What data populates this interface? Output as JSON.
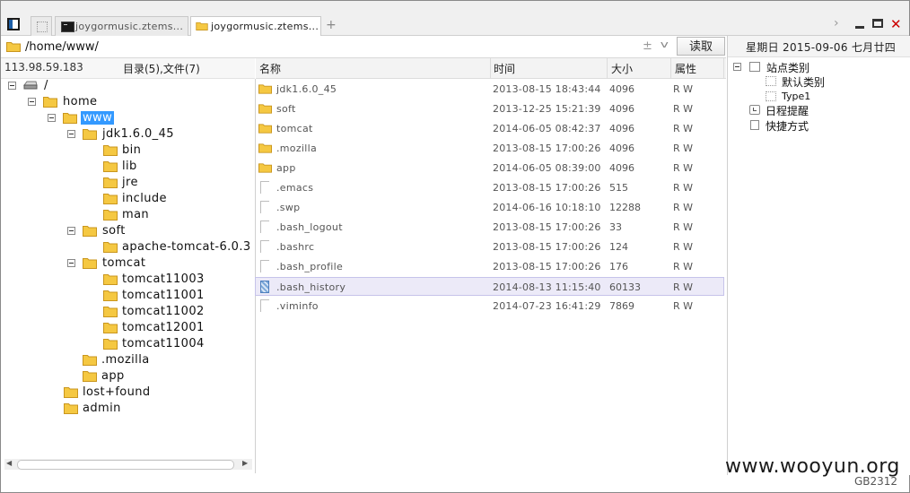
{
  "tabs": [
    {
      "label": "joygormusic.ztems..."
    },
    {
      "label": "joygormusic.ztems..."
    }
  ],
  "path": {
    "value": "/home/www/",
    "plus_minus": "±",
    "read_button": "读取"
  },
  "left_header": {
    "ip": "113.98.59.183",
    "counts": "目录(5),文件(7)"
  },
  "columns": {
    "name": "名称",
    "time": "时间",
    "size": "大小",
    "attr": "属性"
  },
  "tree": {
    "root": "/",
    "home": "home",
    "www": "www",
    "jdk": "jdk1.6.0_45",
    "bin": "bin",
    "lib": "lib",
    "jre": "jre",
    "include": "include",
    "man": "man",
    "soft": "soft",
    "apache": "apache-tomcat-6.0.3",
    "tomcat": "tomcat",
    "t11003": "tomcat11003",
    "t11001": "tomcat11001",
    "t11002": "tomcat11002",
    "t12001": "tomcat12001",
    "t11004": "tomcat11004",
    "mozilla": ".mozilla",
    "app": "app",
    "lostfound": "lost+found",
    "admin": "admin"
  },
  "files": [
    {
      "name": "jdk1.6.0_45",
      "time": "2013-08-15 18:43:44",
      "size": "4096",
      "attr": "R W",
      "type": "folder"
    },
    {
      "name": "soft",
      "time": "2013-12-25 15:21:39",
      "size": "4096",
      "attr": "R W",
      "type": "folder"
    },
    {
      "name": "tomcat",
      "time": "2014-06-05 08:42:37",
      "size": "4096",
      "attr": "R W",
      "type": "folder"
    },
    {
      "name": ".mozilla",
      "time": "2013-08-15 17:00:26",
      "size": "4096",
      "attr": "R W",
      "type": "folder"
    },
    {
      "name": "app",
      "time": "2014-06-05 08:39:00",
      "size": "4096",
      "attr": "R W",
      "type": "folder"
    },
    {
      "name": ".emacs",
      "time": "2013-08-15 17:00:26",
      "size": "515",
      "attr": "R W",
      "type": "file"
    },
    {
      "name": ".swp",
      "time": "2014-06-16 10:18:10",
      "size": "12288",
      "attr": "R W",
      "type": "file"
    },
    {
      "name": ".bash_logout",
      "time": "2013-08-15 17:00:26",
      "size": "33",
      "attr": "R W",
      "type": "file"
    },
    {
      "name": ".bashrc",
      "time": "2013-08-15 17:00:26",
      "size": "124",
      "attr": "R W",
      "type": "file"
    },
    {
      "name": ".bash_profile",
      "time": "2013-08-15 17:00:26",
      "size": "176",
      "attr": "R W",
      "type": "file"
    },
    {
      "name": ".bash_history",
      "time": "2014-08-13 11:15:40",
      "size": "60133",
      "attr": "R W",
      "type": "file",
      "selected": true
    },
    {
      "name": ".viminfo",
      "time": "2014-07-23 16:41:29",
      "size": "7869",
      "attr": "R W",
      "type": "file"
    }
  ],
  "side": {
    "date": "星期日 2015-09-06 七月廿四",
    "site_category": "站点类别",
    "default_category": "默认类别",
    "type1": "Type1",
    "schedule": "日程提醒",
    "shortcuts": "快捷方式"
  },
  "watermark": "www.wooyun.org",
  "encoding": "GB2312",
  "colors": {
    "folder": "#f5c842",
    "folder_dark": "#c9961e",
    "selection": "#3399ff",
    "row_selected": "#eceaf8",
    "close": "#cc0000"
  }
}
